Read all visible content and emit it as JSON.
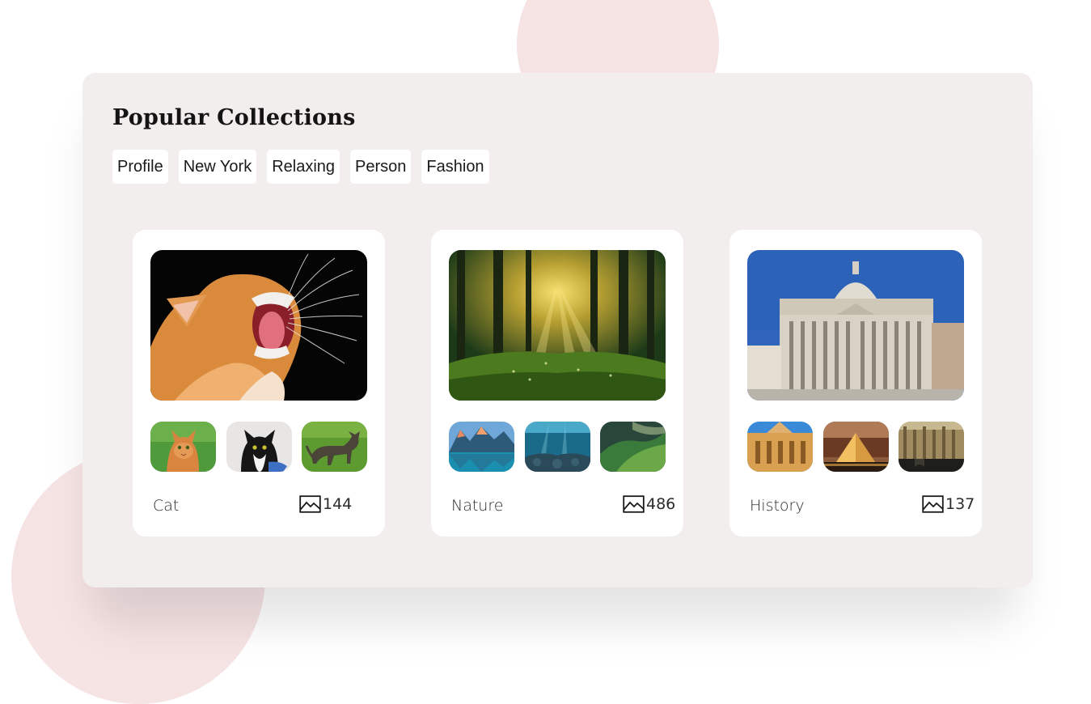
{
  "header": {
    "title": "Popular Collections"
  },
  "tags": [
    "Profile",
    "New York",
    "Relaxing",
    "Person",
    "Fashion"
  ],
  "collections": [
    {
      "name": "Cat",
      "count": "144",
      "icon": "image-icon",
      "main_image": "orange-cat-yawning",
      "thumbnails": [
        "orange-tabby-cat-on-grass",
        "black-white-cat",
        "tabby-cat-walking-on-grass"
      ]
    },
    {
      "name": "Nature",
      "count": "486",
      "icon": "image-icon",
      "main_image": "sunlit-forest",
      "thumbnails": [
        "mountain-lake",
        "underwater-reef",
        "green-hills"
      ]
    },
    {
      "name": "History",
      "count": "137",
      "icon": "image-icon",
      "main_image": "st-peters-basilica",
      "thumbnails": [
        "florence-cathedral",
        "louvre-pyramid-night",
        "gothic-palace"
      ]
    }
  ],
  "colors": {
    "panel": "#f2eeee",
    "card": "#ffffff",
    "blob": "#f6e3e4",
    "text": "#2b2b2b"
  }
}
